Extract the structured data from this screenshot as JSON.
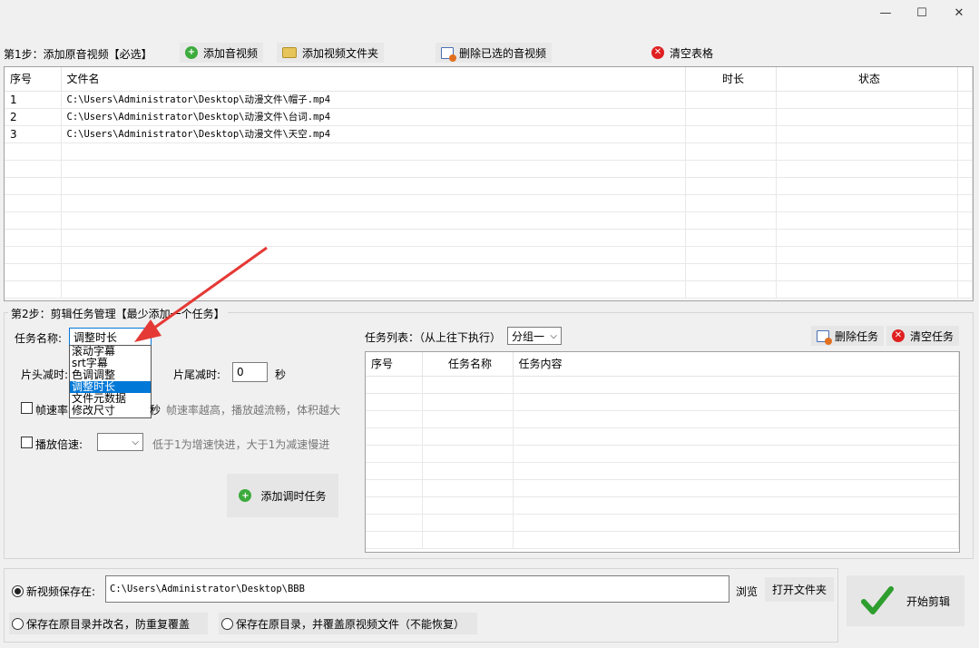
{
  "window": {
    "min": "—",
    "max": "☐",
    "close": "✕"
  },
  "step1": {
    "label": "第1步：添加原音视频【必选】",
    "add_audio": "添加音视频",
    "add_folder": "添加视频文件夹",
    "delete_selected": "删除已选的音视频",
    "clear_table": "清空表格",
    "columns": [
      "序号",
      "文件名",
      "时长",
      "状态"
    ],
    "rows": [
      {
        "no": "1",
        "file": "C:\\Users\\Administrator\\Desktop\\动漫文件\\帽子.mp4",
        "duration": "",
        "status": ""
      },
      {
        "no": "2",
        "file": "C:\\Users\\Administrator\\Desktop\\动漫文件\\台词.mp4",
        "duration": "",
        "status": ""
      },
      {
        "no": "3",
        "file": "C:\\Users\\Administrator\\Desktop\\动漫文件\\天空.mp4",
        "duration": "",
        "status": ""
      }
    ]
  },
  "step2": {
    "label": "第2步：剪辑任务管理【最少添加一个任务】",
    "task_name_label": "任务名称:",
    "task_name_value": "调整时长",
    "dropdown_options": [
      "滚动字幕",
      "srt字幕",
      "色调调整",
      "调整时长",
      "文件元数据",
      "修改尺寸"
    ],
    "dropdown_selected": "调整时长",
    "head_cut_label": "片头减时:",
    "tail_cut_label": "片尾减时:",
    "tail_cut_value": "0",
    "seconds_unit": "秒",
    "framerate_label": "帧速率",
    "framerate_unit": "秒",
    "framerate_hint": "帧速率越高，播放越流畅，体积越大",
    "speed_label": "播放倍速:",
    "speed_hint": "低于1为增速快进，大于1为减速慢进",
    "add_task_button": "添加调时任务",
    "task_list_label": "任务列表：（从上往下执行）",
    "group_value": "分组一",
    "delete_task": "删除任务",
    "clear_tasks": "清空任务",
    "task_columns": [
      "序号",
      "任务名称",
      "任务内容"
    ]
  },
  "output": {
    "save_new_label": "新视频保存在:",
    "save_path": "C:\\Users\\Administrator\\Desktop\\BBB",
    "browse": "浏览",
    "open_folder": "打开文件夹",
    "option_rename": "保存在原目录并改名，防重复覆盖",
    "option_overwrite": "保存在原目录，并覆盖原视频文件（不能恢复）",
    "start_button": "开始剪辑"
  },
  "colors": {
    "accent_selection": "#0078d7",
    "arrow": "#e53935",
    "check_green": "#2e9e2e"
  }
}
